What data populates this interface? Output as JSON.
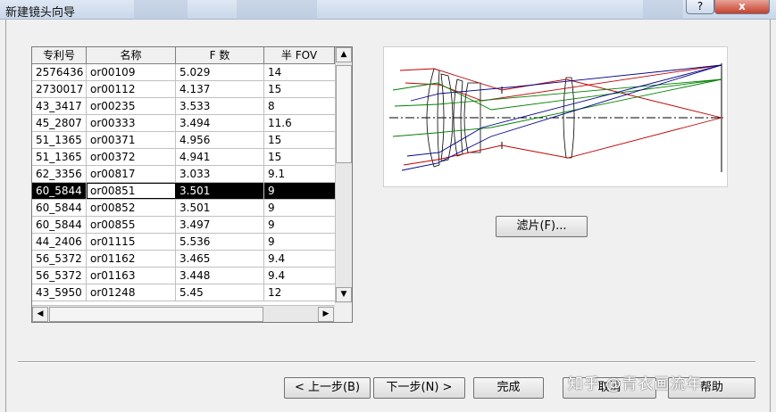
{
  "window": {
    "title": "新建镜头向导",
    "help_label": "?",
    "close_label": "x"
  },
  "table": {
    "columns": [
      "专利号",
      "名称",
      "F 数",
      "半 FOV"
    ],
    "rows": [
      [
        "2576436",
        "or00109",
        "5.029",
        "14"
      ],
      [
        "2730017",
        "or00112",
        "4.137",
        "15"
      ],
      [
        "43_3417",
        "or00235",
        "3.533",
        "8"
      ],
      [
        "45_2807",
        "or00333",
        "3.494",
        "11.6"
      ],
      [
        "51_1365",
        "or00371",
        "4.956",
        "15"
      ],
      [
        "51_1365",
        "or00372",
        "4.941",
        "15"
      ],
      [
        "62_3356",
        "or00817",
        "3.033",
        "9.1"
      ],
      [
        "60_5844",
        "or00851",
        "3.501",
        "9"
      ],
      [
        "60_5844",
        "or00852",
        "3.501",
        "9"
      ],
      [
        "60_5844",
        "or00855",
        "3.497",
        "9"
      ],
      [
        "44_2406",
        "or01115",
        "5.536",
        "9"
      ],
      [
        "56_5372",
        "or01162",
        "3.465",
        "9.4"
      ],
      [
        "56_5372",
        "or01163",
        "3.448",
        "9.4"
      ],
      [
        "43_5950",
        "or01248",
        "5.45",
        "12"
      ]
    ],
    "selected_row": 7
  },
  "preview": {
    "ray_colors": [
      "#c00000",
      "#008000",
      "#00008b"
    ]
  },
  "buttons": {
    "filter": "滤片(F)...",
    "back": "< 上一步(B)",
    "next": "下一步(N) >",
    "finish": "完成",
    "cancel": "取消",
    "help": "帮助"
  },
  "watermark": "知乎 @青衣画流年"
}
